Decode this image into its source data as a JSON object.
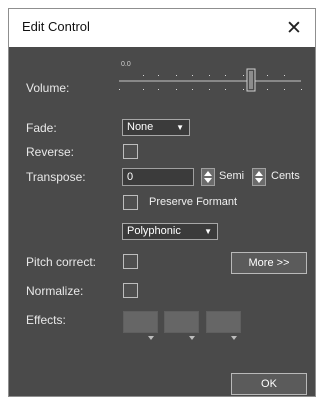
{
  "window": {
    "title": "Edit Control"
  },
  "volume": {
    "label": "Volume:",
    "scale_label": "0.0"
  },
  "fade": {
    "label": "Fade:",
    "value": "None"
  },
  "reverse": {
    "label": "Reverse:"
  },
  "transpose": {
    "label": "Transpose:",
    "value": "0",
    "semi_label": "Semi",
    "cents_label": "Cents"
  },
  "preserve_formant": {
    "label": "Preserve Formant"
  },
  "mode_dropdown": {
    "value": "Polyphonic"
  },
  "pitch_correct": {
    "label": "Pitch correct:"
  },
  "normalize": {
    "label": "Normalize:"
  },
  "effects": {
    "label": "Effects:"
  },
  "buttons": {
    "more": "More >>",
    "ok": "OK"
  }
}
